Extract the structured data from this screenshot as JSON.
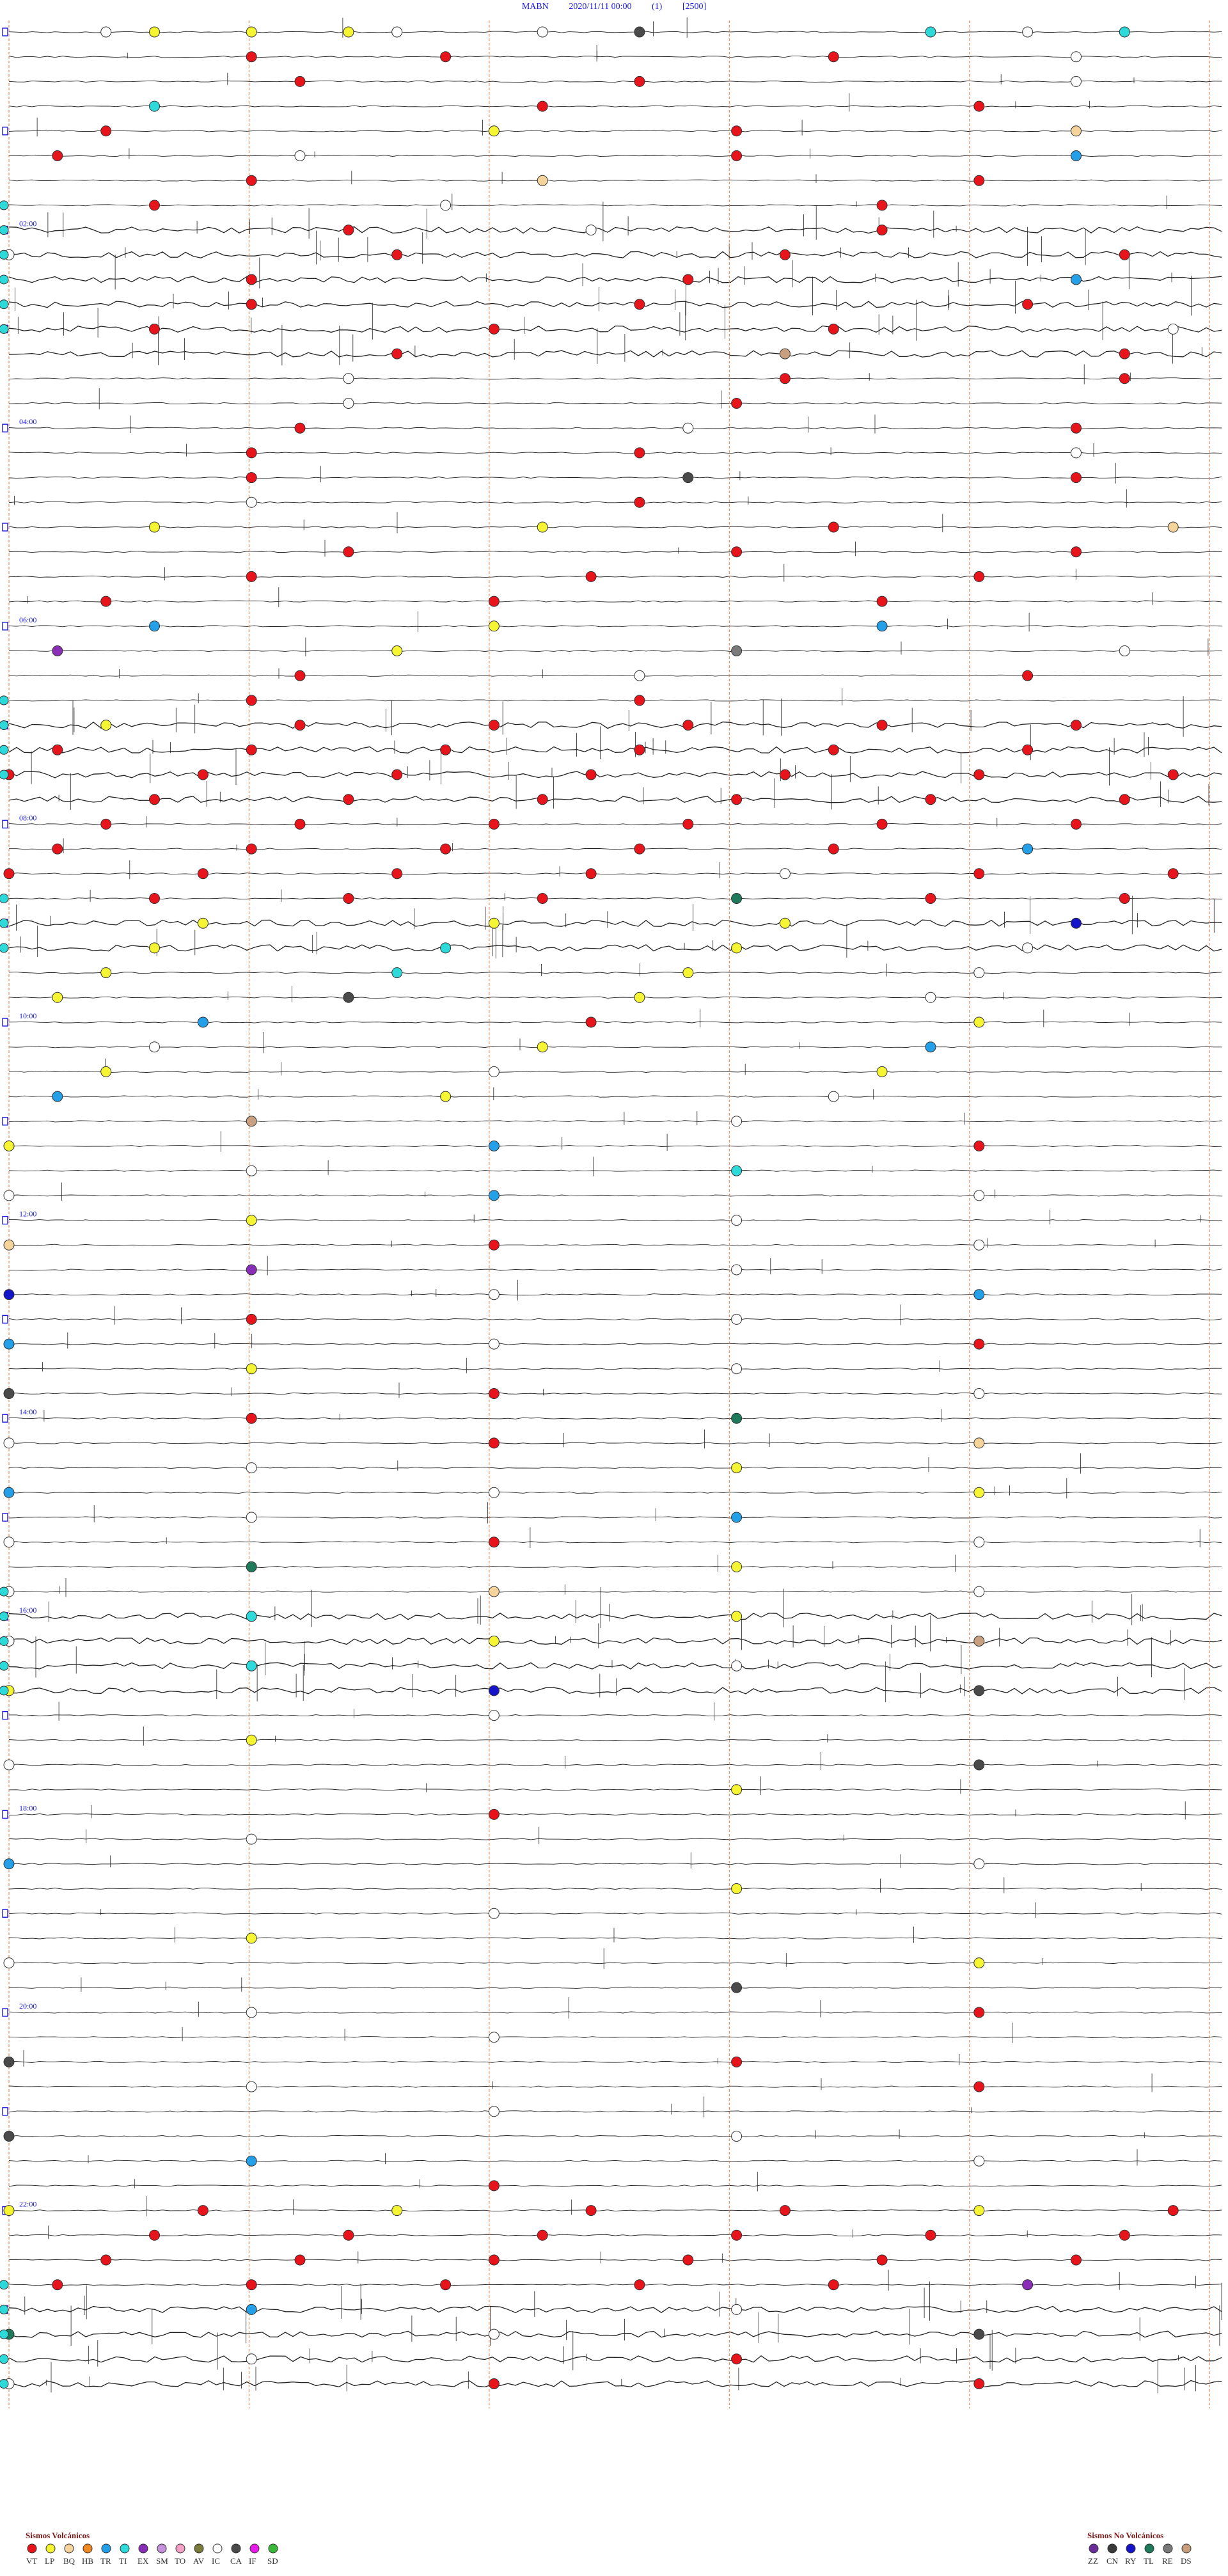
{
  "header": {
    "station": "MABN",
    "datetime": "2020/11/11 00:00",
    "channel": "(1)",
    "scale": "[2500]"
  },
  "chart_data": {
    "type": "scatter",
    "title": "MABN 2020/11/11 00:00 (1) [2500]",
    "rows_per_hour": 4,
    "minutes_per_row": 15,
    "time_labels": [
      "02:00",
      "04:00",
      "06:00",
      "08:00",
      "10:00",
      "12:00",
      "14:00",
      "16:00",
      "18:00",
      "20:00",
      "22:00"
    ],
    "events": [
      {
        "t": 0.02,
        "type": "IC"
      },
      {
        "t": 0.03,
        "type": "LP"
      },
      {
        "t": 0.05,
        "type": "LP"
      },
      {
        "t": 0.07,
        "type": "LP"
      },
      {
        "t": 0.08,
        "type": "IC"
      },
      {
        "t": 0.11,
        "type": "IC"
      },
      {
        "t": 0.13,
        "type": "CA"
      },
      {
        "t": 0.19,
        "type": "TI"
      },
      {
        "t": 0.21,
        "type": "IC"
      },
      {
        "t": 0.23,
        "type": "TI"
      },
      {
        "t": 0.3,
        "type": "VT"
      },
      {
        "t": 0.34,
        "type": "VT"
      },
      {
        "t": 0.42,
        "type": "VT"
      },
      {
        "t": 0.47,
        "type": "IC"
      },
      {
        "t": 0.56,
        "type": "VT"
      },
      {
        "t": 0.63,
        "type": "VT"
      },
      {
        "t": 0.72,
        "type": "IC"
      },
      {
        "t": 0.78,
        "type": "TI"
      },
      {
        "t": 0.86,
        "type": "VT"
      },
      {
        "t": 0.95,
        "type": "VT"
      },
      {
        "t": 1.02,
        "type": "VT"
      },
      {
        "t": 1.1,
        "type": "LP"
      },
      {
        "t": 1.15,
        "type": "VT"
      },
      {
        "t": 1.22,
        "type": "BQ"
      },
      {
        "t": 1.26,
        "type": "VT"
      },
      {
        "t": 1.31,
        "type": "IC"
      },
      {
        "t": 1.4,
        "type": "VT"
      },
      {
        "t": 1.47,
        "type": "TR"
      },
      {
        "t": 1.55,
        "type": "VT"
      },
      {
        "t": 1.61,
        "type": "BQ"
      },
      {
        "t": 1.7,
        "type": "VT"
      },
      {
        "t": 1.78,
        "type": "VT"
      },
      {
        "t": 1.84,
        "type": "IC"
      },
      {
        "t": 1.93,
        "type": "VT"
      },
      {
        "t": 2.07,
        "type": "VT"
      },
      {
        "t": 2.12,
        "type": "IC"
      },
      {
        "t": 2.18,
        "type": "VT"
      },
      {
        "t": 2.25,
        "type": "IC"
      },
      {
        "t": 2.33,
        "type": "VT"
      },
      {
        "t": 2.41,
        "type": "VT"
      },
      {
        "t": 2.48,
        "type": "VT"
      },
      {
        "t": 2.55,
        "type": "VT"
      },
      {
        "t": 2.64,
        "type": "VT"
      },
      {
        "t": 2.72,
        "type": "TR"
      },
      {
        "t": 2.8,
        "type": "VT"
      },
      {
        "t": 2.88,
        "type": "VT"
      },
      {
        "t": 2.96,
        "type": "VT"
      },
      {
        "t": 3.03,
        "type": "VT"
      },
      {
        "t": 3.1,
        "type": "VT"
      },
      {
        "t": 3.17,
        "type": "VT"
      },
      {
        "t": 3.24,
        "type": "IC"
      },
      {
        "t": 3.33,
        "type": "VT"
      },
      {
        "t": 3.41,
        "type": "DS"
      },
      {
        "t": 3.48,
        "type": "VT"
      },
      {
        "t": 3.57,
        "type": "IC"
      },
      {
        "t": 3.66,
        "type": "VT"
      },
      {
        "t": 3.73,
        "type": "VT"
      },
      {
        "t": 3.82,
        "type": "IC"
      },
      {
        "t": 3.9,
        "type": "VT"
      },
      {
        "t": 4.06,
        "type": "VT"
      },
      {
        "t": 4.14,
        "type": "IC"
      },
      {
        "t": 4.22,
        "type": "VT"
      },
      {
        "t": 4.3,
        "type": "VT"
      },
      {
        "t": 4.38,
        "type": "VT"
      },
      {
        "t": 4.47,
        "type": "IC"
      },
      {
        "t": 4.55,
        "type": "VT"
      },
      {
        "t": 4.64,
        "type": "CA"
      },
      {
        "t": 4.72,
        "type": "VT"
      },
      {
        "t": 4.8,
        "type": "IC"
      },
      {
        "t": 4.88,
        "type": "VT"
      },
      {
        "t": 5.03,
        "type": "LP"
      },
      {
        "t": 5.11,
        "type": "LP"
      },
      {
        "t": 5.17,
        "type": "VT"
      },
      {
        "t": 5.24,
        "type": "BQ"
      },
      {
        "t": 5.32,
        "type": "VT"
      },
      {
        "t": 5.4,
        "type": "VT"
      },
      {
        "t": 5.47,
        "type": "VT"
      },
      {
        "t": 5.55,
        "type": "VT"
      },
      {
        "t": 5.62,
        "type": "VT"
      },
      {
        "t": 5.7,
        "type": "VT"
      },
      {
        "t": 5.77,
        "type": "VT"
      },
      {
        "t": 5.85,
        "type": "VT"
      },
      {
        "t": 5.93,
        "type": "VT"
      },
      {
        "t": 6.03,
        "type": "TR"
      },
      {
        "t": 6.1,
        "type": "LP"
      },
      {
        "t": 6.18,
        "type": "TR"
      },
      {
        "t": 6.26,
        "type": "EX"
      },
      {
        "t": 6.33,
        "type": "LP"
      },
      {
        "t": 6.4,
        "type": "RE"
      },
      {
        "t": 6.48,
        "type": "IC"
      },
      {
        "t": 6.56,
        "type": "VT"
      },
      {
        "t": 6.63,
        "type": "IC"
      },
      {
        "t": 6.71,
        "type": "VT"
      },
      {
        "t": 6.8,
        "type": "VT"
      },
      {
        "t": 6.88,
        "type": "VT"
      },
      {
        "t": 7.02,
        "type": "LP"
      },
      {
        "t": 7.06,
        "type": "VT"
      },
      {
        "t": 7.1,
        "type": "VT"
      },
      {
        "t": 7.14,
        "type": "VT"
      },
      {
        "t": 7.18,
        "type": "VT"
      },
      {
        "t": 7.22,
        "type": "VT"
      },
      {
        "t": 7.26,
        "type": "VT"
      },
      {
        "t": 7.3,
        "type": "VT"
      },
      {
        "t": 7.34,
        "type": "VT"
      },
      {
        "t": 7.38,
        "type": "VT"
      },
      {
        "t": 7.42,
        "type": "VT"
      },
      {
        "t": 7.46,
        "type": "VT"
      },
      {
        "t": 7.5,
        "type": "VT"
      },
      {
        "t": 7.54,
        "type": "VT"
      },
      {
        "t": 7.58,
        "type": "VT"
      },
      {
        "t": 7.62,
        "type": "VT"
      },
      {
        "t": 7.66,
        "type": "VT"
      },
      {
        "t": 7.7,
        "type": "VT"
      },
      {
        "t": 7.74,
        "type": "VT"
      },
      {
        "t": 7.78,
        "type": "VT"
      },
      {
        "t": 7.82,
        "type": "VT"
      },
      {
        "t": 7.86,
        "type": "VT"
      },
      {
        "t": 7.9,
        "type": "VT"
      },
      {
        "t": 7.94,
        "type": "VT"
      },
      {
        "t": 7.98,
        "type": "VT"
      },
      {
        "t": 8.02,
        "type": "VT"
      },
      {
        "t": 8.06,
        "type": "VT"
      },
      {
        "t": 8.1,
        "type": "VT"
      },
      {
        "t": 8.14,
        "type": "VT"
      },
      {
        "t": 8.18,
        "type": "VT"
      },
      {
        "t": 8.22,
        "type": "VT"
      },
      {
        "t": 8.26,
        "type": "VT"
      },
      {
        "t": 8.3,
        "type": "VT"
      },
      {
        "t": 8.34,
        "type": "VT"
      },
      {
        "t": 8.38,
        "type": "VT"
      },
      {
        "t": 8.42,
        "type": "VT"
      },
      {
        "t": 8.46,
        "type": "TR"
      },
      {
        "t": 8.5,
        "type": "VT"
      },
      {
        "t": 8.54,
        "type": "VT"
      },
      {
        "t": 8.58,
        "type": "VT"
      },
      {
        "t": 8.62,
        "type": "VT"
      },
      {
        "t": 8.66,
        "type": "IC"
      },
      {
        "t": 8.7,
        "type": "VT"
      },
      {
        "t": 8.74,
        "type": "VT"
      },
      {
        "t": 8.78,
        "type": "VT"
      },
      {
        "t": 8.82,
        "type": "VT"
      },
      {
        "t": 8.86,
        "type": "VT"
      },
      {
        "t": 8.9,
        "type": "TL"
      },
      {
        "t": 8.94,
        "type": "VT"
      },
      {
        "t": 8.98,
        "type": "VT"
      },
      {
        "t": 9.04,
        "type": "LP"
      },
      {
        "t": 9.1,
        "type": "LP"
      },
      {
        "t": 9.16,
        "type": "LP"
      },
      {
        "t": 9.22,
        "type": "RY"
      },
      {
        "t": 9.28,
        "type": "LP"
      },
      {
        "t": 9.34,
        "type": "TI"
      },
      {
        "t": 9.4,
        "type": "LP"
      },
      {
        "t": 9.46,
        "type": "IC"
      },
      {
        "t": 9.52,
        "type": "LP"
      },
      {
        "t": 9.58,
        "type": "TI"
      },
      {
        "t": 9.64,
        "type": "LP"
      },
      {
        "t": 9.7,
        "type": "IC"
      },
      {
        "t": 9.76,
        "type": "LP"
      },
      {
        "t": 9.82,
        "type": "CA"
      },
      {
        "t": 9.88,
        "type": "LP"
      },
      {
        "t": 9.94,
        "type": "IC"
      },
      {
        "t": 10.04,
        "type": "TR"
      },
      {
        "t": 10.12,
        "type": "VT"
      },
      {
        "t": 10.2,
        "type": "LP"
      },
      {
        "t": 10.28,
        "type": "IC"
      },
      {
        "t": 10.36,
        "type": "LP"
      },
      {
        "t": 10.44,
        "type": "TR"
      },
      {
        "t": 10.52,
        "type": "LP"
      },
      {
        "t": 10.6,
        "type": "IC"
      },
      {
        "t": 10.68,
        "type": "LP"
      },
      {
        "t": 10.76,
        "type": "TR"
      },
      {
        "t": 10.84,
        "type": "LP"
      },
      {
        "t": 10.92,
        "type": "IC"
      },
      {
        "t": 11.05,
        "type": "DS"
      },
      {
        "t": 11.15,
        "type": "IC"
      },
      {
        "t": 11.25,
        "type": "LP"
      },
      {
        "t": 11.35,
        "type": "TR"
      },
      {
        "t": 11.45,
        "type": "VT"
      },
      {
        "t": 11.55,
        "type": "IC"
      },
      {
        "t": 11.65,
        "type": "TI"
      },
      {
        "t": 11.75,
        "type": "IC"
      },
      {
        "t": 11.85,
        "type": "TR"
      },
      {
        "t": 11.95,
        "type": "IC"
      },
      {
        "t": 12.05,
        "type": "LP"
      },
      {
        "t": 12.15,
        "type": "IC"
      },
      {
        "t": 12.25,
        "type": "BQ"
      },
      {
        "t": 12.35,
        "type": "VT"
      },
      {
        "t": 12.45,
        "type": "IC"
      },
      {
        "t": 12.55,
        "type": "EX"
      },
      {
        "t": 12.65,
        "type": "IC"
      },
      {
        "t": 12.75,
        "type": "RY"
      },
      {
        "t": 12.85,
        "type": "IC"
      },
      {
        "t": 12.95,
        "type": "TR"
      },
      {
        "t": 13.05,
        "type": "VT"
      },
      {
        "t": 13.15,
        "type": "IC"
      },
      {
        "t": 13.25,
        "type": "TR"
      },
      {
        "t": 13.35,
        "type": "IC"
      },
      {
        "t": 13.45,
        "type": "VT"
      },
      {
        "t": 13.55,
        "type": "LP"
      },
      {
        "t": 13.65,
        "type": "IC"
      },
      {
        "t": 13.75,
        "type": "CA"
      },
      {
        "t": 13.85,
        "type": "VT"
      },
      {
        "t": 13.95,
        "type": "IC"
      },
      {
        "t": 14.05,
        "type": "VT"
      },
      {
        "t": 14.15,
        "type": "TL"
      },
      {
        "t": 14.25,
        "type": "IC"
      },
      {
        "t": 14.35,
        "type": "VT"
      },
      {
        "t": 14.45,
        "type": "BQ"
      },
      {
        "t": 14.55,
        "type": "IC"
      },
      {
        "t": 14.65,
        "type": "LP"
      },
      {
        "t": 14.75,
        "type": "TR"
      },
      {
        "t": 14.85,
        "type": "IC"
      },
      {
        "t": 14.95,
        "type": "LP"
      },
      {
        "t": 15.05,
        "type": "IC"
      },
      {
        "t": 15.15,
        "type": "TR"
      },
      {
        "t": 15.25,
        "type": "IC"
      },
      {
        "t": 15.35,
        "type": "VT"
      },
      {
        "t": 15.45,
        "type": "IC"
      },
      {
        "t": 15.55,
        "type": "TL"
      },
      {
        "t": 15.65,
        "type": "LP"
      },
      {
        "t": 15.75,
        "type": "IC"
      },
      {
        "t": 15.85,
        "type": "BQ"
      },
      {
        "t": 15.95,
        "type": "IC"
      },
      {
        "t": 16.05,
        "type": "TI"
      },
      {
        "t": 16.15,
        "type": "LP"
      },
      {
        "t": 16.25,
        "type": "IC"
      },
      {
        "t": 16.35,
        "type": "LP"
      },
      {
        "t": 16.45,
        "type": "DS"
      },
      {
        "t": 16.55,
        "type": "TI"
      },
      {
        "t": 16.65,
        "type": "IC"
      },
      {
        "t": 16.75,
        "type": "LP"
      },
      {
        "t": 16.85,
        "type": "RY"
      },
      {
        "t": 16.95,
        "type": "CA"
      },
      {
        "t": 17.1,
        "type": "IC"
      },
      {
        "t": 17.3,
        "type": "LP"
      },
      {
        "t": 17.5,
        "type": "IC"
      },
      {
        "t": 17.7,
        "type": "CA"
      },
      {
        "t": 17.9,
        "type": "LP"
      },
      {
        "t": 18.1,
        "type": "VT"
      },
      {
        "t": 18.3,
        "type": "IC"
      },
      {
        "t": 18.5,
        "type": "TR"
      },
      {
        "t": 18.7,
        "type": "IC"
      },
      {
        "t": 18.9,
        "type": "LP"
      },
      {
        "t": 19.1,
        "type": "IC"
      },
      {
        "t": 19.3,
        "type": "LP"
      },
      {
        "t": 19.5,
        "type": "IC"
      },
      {
        "t": 19.7,
        "type": "LP"
      },
      {
        "t": 19.9,
        "type": "CA"
      },
      {
        "t": 20.05,
        "type": "IC"
      },
      {
        "t": 20.2,
        "type": "VT"
      },
      {
        "t": 20.35,
        "type": "IC"
      },
      {
        "t": 20.5,
        "type": "CA"
      },
      {
        "t": 20.65,
        "type": "VT"
      },
      {
        "t": 20.8,
        "type": "IC"
      },
      {
        "t": 20.95,
        "type": "VT"
      },
      {
        "t": 21.1,
        "type": "IC"
      },
      {
        "t": 21.25,
        "type": "CA"
      },
      {
        "t": 21.4,
        "type": "IC"
      },
      {
        "t": 21.55,
        "type": "TR"
      },
      {
        "t": 21.7,
        "type": "IC"
      },
      {
        "t": 21.85,
        "type": "VT"
      },
      {
        "t": 22.0,
        "type": "LP"
      },
      {
        "t": 22.04,
        "type": "VT"
      },
      {
        "t": 22.08,
        "type": "LP"
      },
      {
        "t": 22.12,
        "type": "VT"
      },
      {
        "t": 22.16,
        "type": "VT"
      },
      {
        "t": 22.2,
        "type": "LP"
      },
      {
        "t": 22.24,
        "type": "VT"
      },
      {
        "t": 22.28,
        "type": "VT"
      },
      {
        "t": 22.32,
        "type": "VT"
      },
      {
        "t": 22.36,
        "type": "VT"
      },
      {
        "t": 22.4,
        "type": "VT"
      },
      {
        "t": 22.44,
        "type": "VT"
      },
      {
        "t": 22.48,
        "type": "VT"
      },
      {
        "t": 22.52,
        "type": "VT"
      },
      {
        "t": 22.56,
        "type": "VT"
      },
      {
        "t": 22.6,
        "type": "VT"
      },
      {
        "t": 22.64,
        "type": "VT"
      },
      {
        "t": 22.68,
        "type": "VT"
      },
      {
        "t": 22.72,
        "type": "VT"
      },
      {
        "t": 22.76,
        "type": "VT"
      },
      {
        "t": 22.8,
        "type": "VT"
      },
      {
        "t": 22.84,
        "type": "VT"
      },
      {
        "t": 22.88,
        "type": "VT"
      },
      {
        "t": 22.92,
        "type": "VT"
      },
      {
        "t": 22.96,
        "type": "EX"
      },
      {
        "t": 23.05,
        "type": "TR"
      },
      {
        "t": 23.15,
        "type": "IC"
      },
      {
        "t": 23.25,
        "type": "TL"
      },
      {
        "t": 23.35,
        "type": "IC"
      },
      {
        "t": 23.45,
        "type": "CA"
      },
      {
        "t": 23.55,
        "type": "IC"
      },
      {
        "t": 23.65,
        "type": "VT"
      },
      {
        "t": 23.75,
        "type": "IC"
      },
      {
        "t": 23.85,
        "type": "VT"
      },
      {
        "t": 23.95,
        "type": "VT"
      }
    ],
    "tremor_bursts": [
      {
        "t_start": 1.88,
        "t_end": 3.25
      },
      {
        "t_start": 6.76,
        "t_end": 7.75
      },
      {
        "t_start": 8.86,
        "t_end": 9.32
      },
      {
        "t_start": 15.97,
        "t_end": 16.95
      },
      {
        "t_start": 22.95,
        "t_end": 24.1
      }
    ],
    "legend_volcanic": {
      "title": "Sismos Volcánicos",
      "items": [
        {
          "code": "VT",
          "color": "#e8141c"
        },
        {
          "code": "LP",
          "color": "#f5f534"
        },
        {
          "code": "BQ",
          "color": "#f5d49c"
        },
        {
          "code": "HB",
          "color": "#f08a24"
        },
        {
          "code": "TR",
          "color": "#24a0e8"
        },
        {
          "code": "TI",
          "color": "#2ed9d9"
        },
        {
          "code": "EX",
          "color": "#8a2eb8"
        },
        {
          "code": "SM",
          "color": "#c490d9"
        },
        {
          "code": "TO",
          "color": "#f5a0c4"
        },
        {
          "code": "AV",
          "color": "#7a7a3a"
        },
        {
          "code": "IC",
          "color": "#ffffff"
        },
        {
          "code": "CA",
          "color": "#4a4a4a"
        },
        {
          "code": "IF",
          "color": "#e81ce8"
        },
        {
          "code": "SD",
          "color": "#3ab83a"
        }
      ]
    },
    "legend_nonvolcanic": {
      "title": "Sismos No Volcánicos",
      "items": [
        {
          "code": "ZZ",
          "color": "#6a2e9a"
        },
        {
          "code": "CN",
          "color": "#3a3a3a"
        },
        {
          "code": "RY",
          "color": "#1414c8"
        },
        {
          "code": "TL",
          "color": "#1e7a5a"
        },
        {
          "code": "RE",
          "color": "#7a7a7a"
        },
        {
          "code": "DS",
          "color": "#c8a080"
        }
      ]
    }
  }
}
